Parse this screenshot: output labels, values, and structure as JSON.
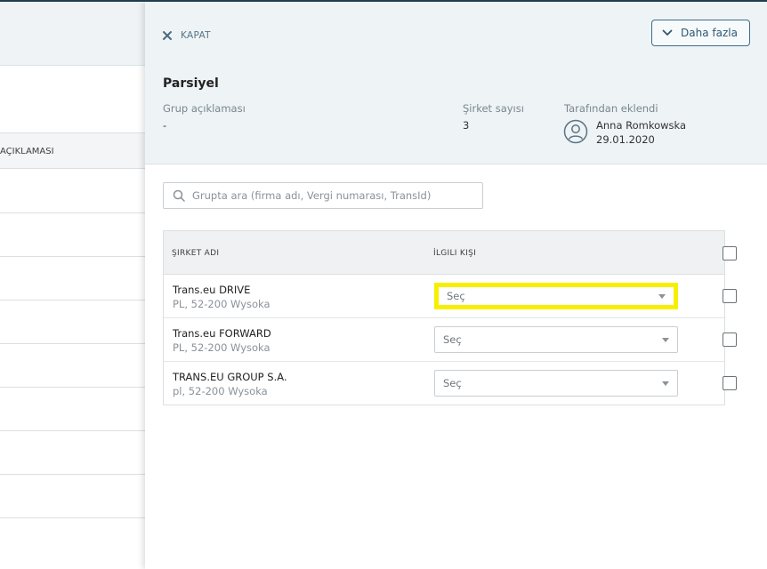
{
  "background": {
    "column_header": "AÇIKLAMASI"
  },
  "panel": {
    "close_label": "KAPAT",
    "more_button_label": "Daha fazla",
    "title": "Parsiyel",
    "group_description_label": "Grup açıklaması",
    "group_description_value": "-",
    "company_count_label": "Şirket sayısı",
    "company_count_value": "3",
    "added_by_label": "Tarafından eklendi",
    "added_by_name": "Anna Romkowska",
    "added_by_date": "29.01.2020"
  },
  "search": {
    "placeholder": "Grupta ara (firma adı, Vergi numarası, TransId)"
  },
  "table": {
    "headers": {
      "company_name": "ŞIRKET ADI",
      "contact_person": "İLGILI KIŞI"
    },
    "rows": [
      {
        "name": "Trans.eu DRIVE",
        "address": "PL, 52-200 Wysoka",
        "contact_value": "Seç",
        "highlighted": true
      },
      {
        "name": "Trans.eu FORWARD",
        "address": "PL, 52-200 Wysoka",
        "contact_value": "Seç",
        "highlighted": false
      },
      {
        "name": "TRANS.EU GROUP S.A.",
        "address": "pl, 52-200 Wysoka",
        "contact_value": "Seç",
        "highlighted": false
      }
    ]
  },
  "colors": {
    "accent": "#2b5875",
    "header_bg": "#eef3f5",
    "highlight": "#f7ef00"
  },
  "icons": {
    "close": "close-icon",
    "more": "chevron-down-icon",
    "avatar": "user-circle-icon",
    "search": "search-icon",
    "dropdown": "caret-down-icon"
  }
}
